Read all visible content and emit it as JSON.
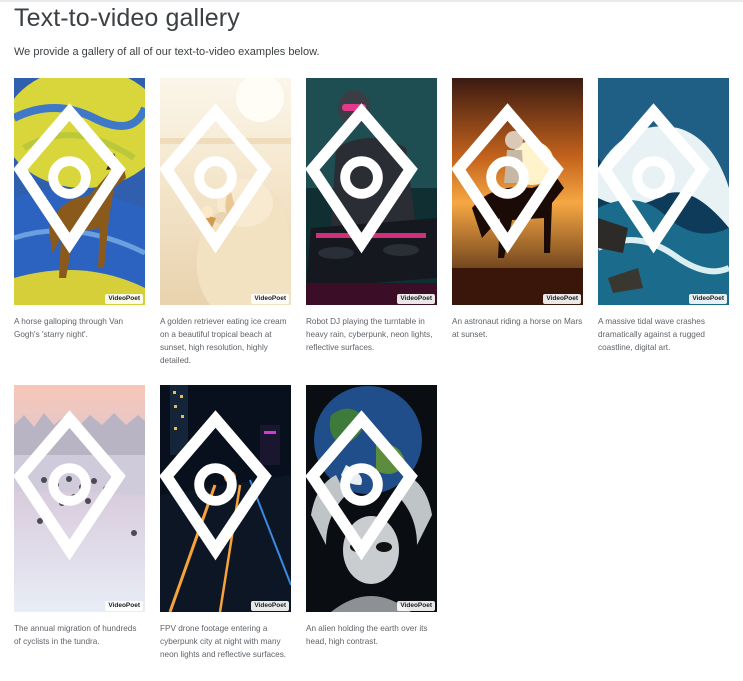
{
  "page": {
    "title": "Text-to-video gallery",
    "intro": "We provide a gallery of all of our text-to-video examples below."
  },
  "watermark": "VideoPoet",
  "gallery": [
    {
      "caption": "A horse galloping through Van Gogh's 'starry night'."
    },
    {
      "caption": "A golden retriever eating ice cream on a beautiful tropical beach at sunset, high resolution, highly detailed."
    },
    {
      "caption": "Robot DJ playing the turntable in heavy rain, cyberpunk, neon lights, reflective surfaces."
    },
    {
      "caption": "An astronaut riding a horse on Mars at sunset."
    },
    {
      "caption": "A massive tidal wave crashes dramatically against a rugged coastline, digital art."
    },
    {
      "caption": "The annual migration of hundreds of cyclists in the tundra."
    },
    {
      "caption": "FPV drone footage entering a cyberpunk city at night with many neon lights and reflective surfaces."
    },
    {
      "caption": "An alien holding the earth over its head, high contrast."
    }
  ]
}
